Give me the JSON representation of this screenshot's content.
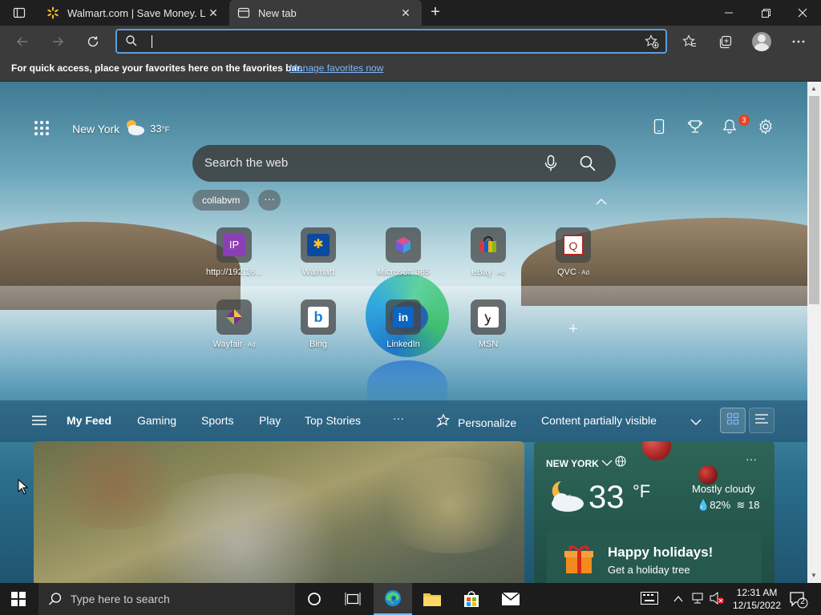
{
  "browser": {
    "tabs": [
      {
        "title": "Walmart.com | Save Money. Live",
        "favicon": "walmart-spark-icon",
        "active": false
      },
      {
        "title": "New tab",
        "favicon": "new-tab-page-icon",
        "active": true
      }
    ],
    "address_bar": {
      "value": "",
      "placeholder": ""
    },
    "favorites_bar": {
      "hint": "For quick access, place your favorites here on the favorites bar.",
      "manage_link": "Manage favorites now"
    }
  },
  "ntp": {
    "weather": {
      "city": "New York",
      "temp": "33",
      "unit": "°F",
      "icon": "partly-cloudy-icon"
    },
    "notifications_count": "3",
    "search": {
      "placeholder": "Search the web"
    },
    "chips": [
      {
        "label": "collabvm"
      }
    ],
    "chip_more": "···",
    "quick_links": [
      {
        "label": "http://192.16...",
        "ad": "",
        "icon": "ip-icon",
        "color": "#8a3fb5",
        "glyph": "IP"
      },
      {
        "label": "Walmart",
        "ad": "",
        "icon": "walmart-icon",
        "color": "#0a4aa0",
        "glyph": "✱"
      },
      {
        "label": "Microsoft 365",
        "ad": "",
        "icon": "microsoft-365-icon",
        "color": "#5a4fcf",
        "glyph": ""
      },
      {
        "label": "eBay",
        "ad": "· Ad",
        "icon": "ebay-icon",
        "color": "#1f1f1f",
        "glyph": ""
      },
      {
        "label": "QVC",
        "ad": "· Ad",
        "icon": "qvc-icon",
        "color": "#ffffff",
        "glyph": "Q"
      },
      {
        "label": "Wayfair",
        "ad": "· Ad",
        "icon": "wayfair-icon",
        "color": "#7b2d8e",
        "glyph": "◆"
      },
      {
        "label": "Bing",
        "ad": "",
        "icon": "bing-icon",
        "color": "#1c7ad9",
        "glyph": "b"
      },
      {
        "label": "LinkedIn",
        "ad": "",
        "icon": "linkedin-icon",
        "color": "#0a66c2",
        "glyph": "in"
      },
      {
        "label": "MSN",
        "ad": "",
        "icon": "msn-icon",
        "color": "#111111",
        "glyph": "ꭚ"
      }
    ],
    "feed_nav": {
      "items": [
        "My Feed",
        "Gaming",
        "Sports",
        "Play",
        "Top Stories"
      ],
      "more": "···",
      "personalize": "Personalize",
      "visibility": "Content partially visible"
    },
    "weather_card": {
      "location": "NEW YORK",
      "temp": "33",
      "unit": "°F",
      "condition": "Mostly cloudy",
      "humidity": "82%",
      "wind": "18",
      "promo_title": "Happy holidays!",
      "promo_sub": "Get a holiday tree",
      "more": "···"
    }
  },
  "taskbar": {
    "search_placeholder": "Type here to search",
    "time": "12:31 AM",
    "date": "12/15/2022",
    "notification_count": "2"
  },
  "colors": {
    "accent": "#5d9edb",
    "link": "#7ab8ff",
    "badge": "#e0452b"
  }
}
